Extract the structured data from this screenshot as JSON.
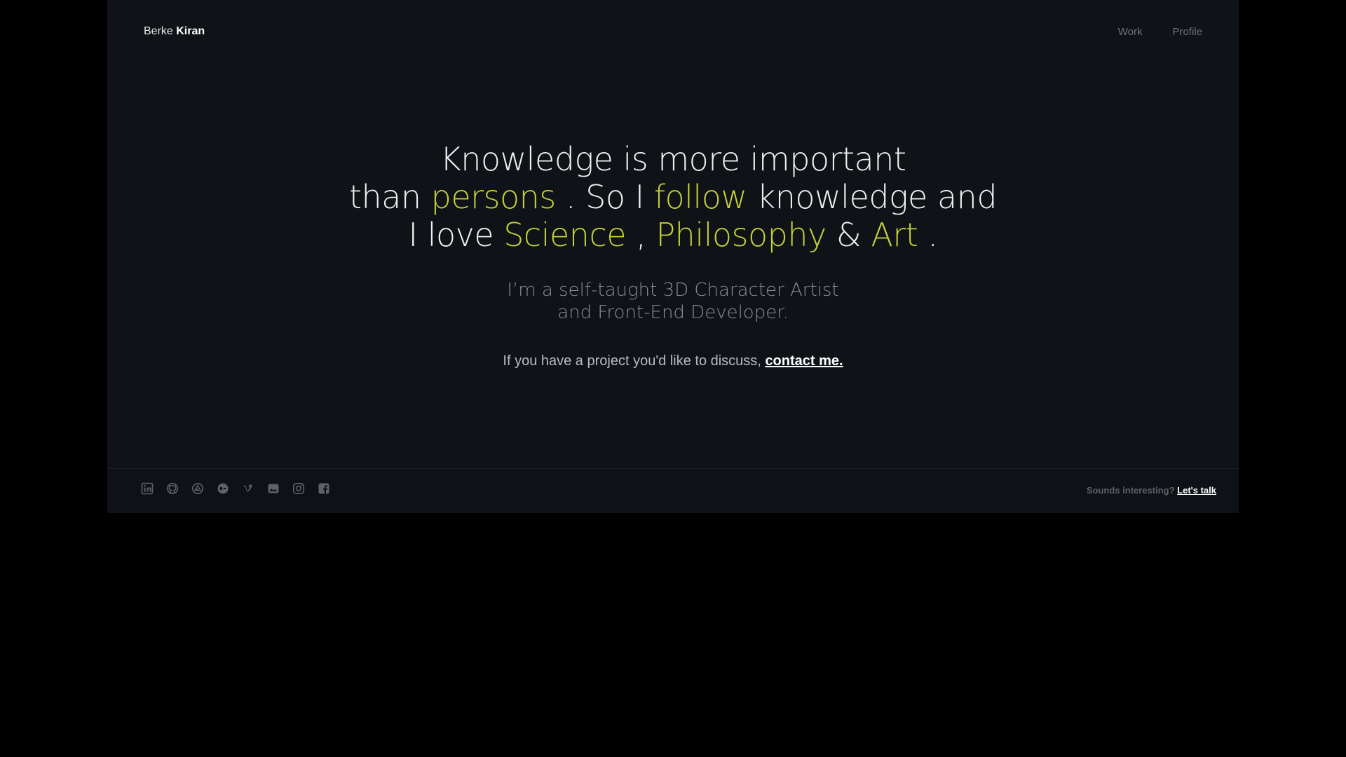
{
  "brand": {
    "first": "Berke",
    "last": "Kiran"
  },
  "nav": {
    "work": "Work",
    "profile": "Profile"
  },
  "hero": {
    "line1": "Knowledge is more important",
    "line2": {
      "a": "than",
      "persons": "persons",
      "b": ". So I",
      "follow": "follow",
      "c": "knowledge and"
    },
    "line3": {
      "a": "I love",
      "science": "Science",
      "b": ",",
      "philosophy": "Philosophy",
      "c": "&",
      "art": "Art",
      "d": "."
    },
    "sub_line1": "I’m a self-taught 3D Character Artist",
    "sub_line2": "and Front-End Developer.",
    "cta_text": "If you have a project you'd like to discuss,",
    "cta_link": "contact me."
  },
  "footer": {
    "socials": [
      "linkedin-icon",
      "github-icon",
      "artstation-icon",
      "behance-icon",
      "vimeo-icon",
      "photo-icon",
      "instagram-icon",
      "facebook-icon"
    ],
    "talk_text": "Sounds interesting?",
    "talk_link": "Let's talk"
  },
  "colors": {
    "accent": "#c4cf3a",
    "background": "#0f1216",
    "outer": "#000000"
  }
}
